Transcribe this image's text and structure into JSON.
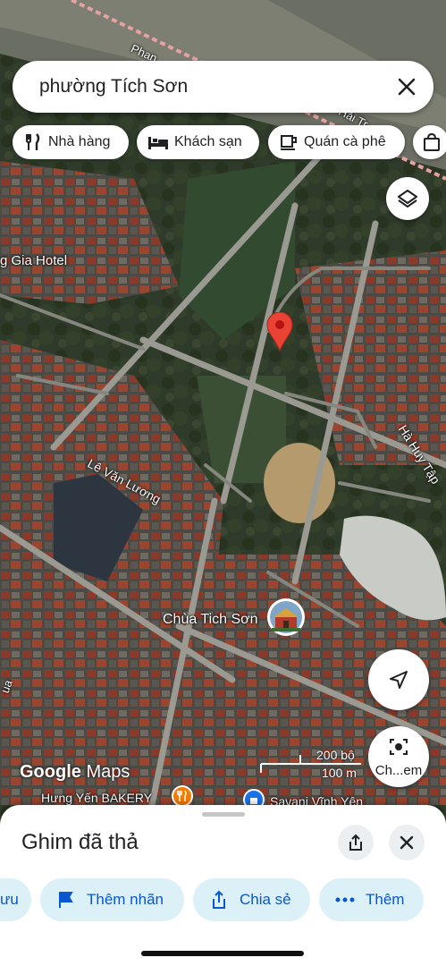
{
  "search": {
    "query": "phường Tích Sơn"
  },
  "chips": [
    {
      "label": "Nhà hàng",
      "icon": "fork-knife-icon"
    },
    {
      "label": "Khách sạn",
      "icon": "bed-icon"
    },
    {
      "label": "Quán cà phê",
      "icon": "coffee-cup-icon"
    },
    {
      "label": "",
      "icon": "shopping-bag-icon"
    }
  ],
  "map": {
    "labels": {
      "street_phan": "Phan",
      "street_hai_tr": "Hải Tr",
      "hotel": "g Gia Hotel",
      "street_le_van_luong": "Lê Văn Lương",
      "street_ha_huy_tap": "Hà Huy Tập",
      "pagoda": "Chùa Tich Sơn",
      "street_left": "ua",
      "bakery": "Hưng Yến BAKERY",
      "savani": "Savani Vĩnh Yên"
    },
    "pin_color": "#ea4335",
    "google_maps": {
      "google": "Google",
      "maps": "Maps"
    },
    "scale": {
      "feet": "200 bộ",
      "meters": "100 m"
    },
    "lens_label": "Ch...em"
  },
  "sheet": {
    "title": "Ghim đã thả",
    "actions": {
      "save": "ưu",
      "add_label": "Thêm nhãn",
      "share": "Chia sẻ",
      "more": "Thêm"
    }
  },
  "colors": {
    "accent": "#0b57d0",
    "chip_bg": "#dbf0f7"
  }
}
